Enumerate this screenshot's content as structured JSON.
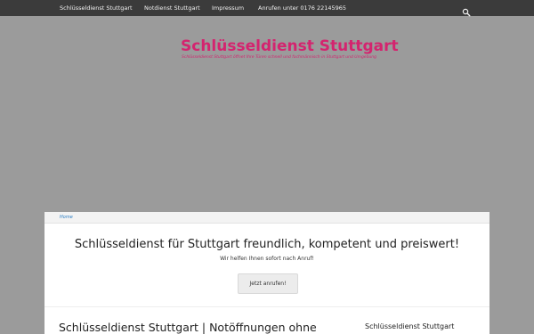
{
  "nav": {
    "items": [
      {
        "label": "Schlüsseldienst Stuttgart"
      },
      {
        "label": "Notdienst Stuttgart"
      },
      {
        "label": "Impressum"
      },
      {
        "label": "Anrufen unter 0176 22145965"
      }
    ],
    "search_icon": "search-icon"
  },
  "header": {
    "title": "Schlüsseldienst Stuttgart",
    "description": "Schlüsseldienst Stuttgart öffnet Ihre Türen schnell und fachmännisch in Stuttgart und Umgebung"
  },
  "breadcrumb": {
    "home": "Home"
  },
  "hero": {
    "title": "Schlüsseldienst für Stuttgart freundlich, kompetent und preiswert!",
    "subtitle": "Wir helfen Ihnen sofort nach Anruf!",
    "button": "Jetzt anrufen!"
  },
  "main": {
    "post_title": "Schlüsseldienst Stuttgart | Notöffnungen ohne"
  },
  "sidebar": {
    "title": "Schlüsseldienst Stuttgart"
  },
  "colors": {
    "brand": "#d4246f",
    "topbar": "#3b3b3b",
    "header_bg": "#9b9b9b",
    "link": "#2a7dc3"
  }
}
